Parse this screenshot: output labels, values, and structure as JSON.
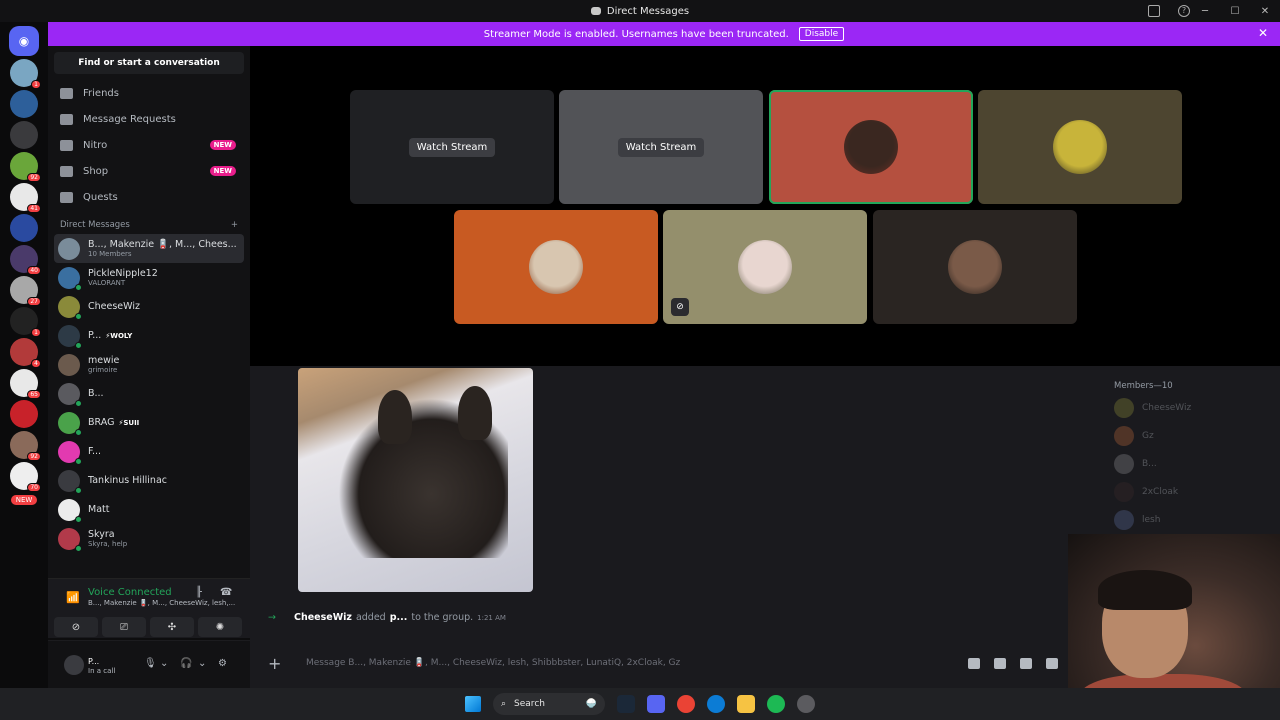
{
  "window": {
    "title": "Direct Messages"
  },
  "banner": {
    "text": "Streamer Mode is enabled. Usernames have been truncated.",
    "button": "Disable"
  },
  "rail": {
    "badges": [
      "1",
      "",
      "",
      "92",
      "41",
      "",
      "40",
      "27",
      "1",
      "4",
      "65",
      "",
      "92",
      "70"
    ],
    "new_label": "NEW"
  },
  "sidebar": {
    "search_label": "Find or start a conversation",
    "nav": [
      {
        "label": "Friends",
        "icon": "friends-icon",
        "badge": ""
      },
      {
        "label": "Message Requests",
        "icon": "mail-icon",
        "badge": ""
      },
      {
        "label": "Nitro",
        "icon": "nitro-icon",
        "badge": "NEW"
      },
      {
        "label": "Shop",
        "icon": "shop-icon",
        "badge": "NEW"
      },
      {
        "label": "Quests",
        "icon": "quests-icon",
        "badge": ""
      }
    ],
    "dm_header": "Direct Messages",
    "dm_add": "+",
    "dms": [
      {
        "name": "B..., Makenzie 🪫, M..., Chees...",
        "sub": "10 Members",
        "tag": "",
        "color": "#7a8c9a",
        "status": false
      },
      {
        "name": "PickleNipple12",
        "sub": "VALORANT",
        "tag": "",
        "color": "#3a6fa0",
        "status": true
      },
      {
        "name": "CheeseWiz",
        "sub": "",
        "tag": "",
        "color": "#8a8a3a",
        "status": true
      },
      {
        "name": "P...",
        "sub": "",
        "tag": "⚡WOLY",
        "color": "#2d3a46",
        "status": true
      },
      {
        "name": "mewie",
        "sub": "grimoire",
        "tag": "",
        "color": "#6b5a4d",
        "status": false
      },
      {
        "name": "B...",
        "sub": "",
        "tag": "",
        "color": "#5a5a5f",
        "status": true
      },
      {
        "name": "BRAG",
        "sub": "",
        "tag": "⚡SUII",
        "color": "#4aa24a",
        "status": true
      },
      {
        "name": "F...",
        "sub": "",
        "tag": "",
        "color": "#e23ab0",
        "status": true
      },
      {
        "name": "Tankinus Hillinac",
        "sub": "",
        "tag": "",
        "color": "#3a3b40",
        "status": true
      },
      {
        "name": "Matt",
        "sub": "",
        "tag": "",
        "color": "#ececec",
        "status": true
      },
      {
        "name": "Skyra",
        "sub": "Skyra, help",
        "tag": "",
        "color": "#b23a4a",
        "status": true
      }
    ]
  },
  "voice": {
    "status": "Voice Connected",
    "channel": "B..., Makenzie 🪫, M..., CheeseWiz, lesh,..."
  },
  "user": {
    "name": "P...",
    "status": "In a call"
  },
  "stage": {
    "watch_label": "Watch Stream",
    "tiles": [
      {
        "kind": "stream",
        "bg": "#1f2023"
      },
      {
        "kind": "stream",
        "bg": "#525357"
      },
      {
        "kind": "face",
        "bg": "#b5503f",
        "face": "#3a2720",
        "speaking": true
      },
      {
        "kind": "face",
        "bg": "#4d4530",
        "face": "#c8b43a"
      },
      {
        "kind": "face",
        "bg": "#c85a22",
        "face": "#d8c6b0"
      },
      {
        "kind": "face",
        "bg": "#948f6c",
        "face": "#e8d6d0",
        "muted": true
      },
      {
        "kind": "face",
        "bg": "#2a2522",
        "face": "#7a5a48"
      }
    ]
  },
  "chat": {
    "system_user": "CheeseWiz",
    "system_action": "added",
    "system_target": "p...",
    "system_rest": "to the group.",
    "system_time": "1:21 AM",
    "placeholder": "Message B..., Makenzie 🪫, M..., CheeseWiz, lesh, Shibbbster, LunatiQ, 2xCloak, Gz"
  },
  "members": {
    "header": "Members—10",
    "list": [
      {
        "name": "CheeseWiz",
        "color": "#8a8a3a"
      },
      {
        "name": "Gz",
        "color": "#b5643a"
      },
      {
        "name": "B...",
        "color": "#8a8a8f"
      },
      {
        "name": "2xCloak",
        "color": "#3a2a2a"
      },
      {
        "name": "lesh",
        "color": "#5a6a9a"
      }
    ]
  },
  "taskbar": {
    "search_label": "Search"
  }
}
